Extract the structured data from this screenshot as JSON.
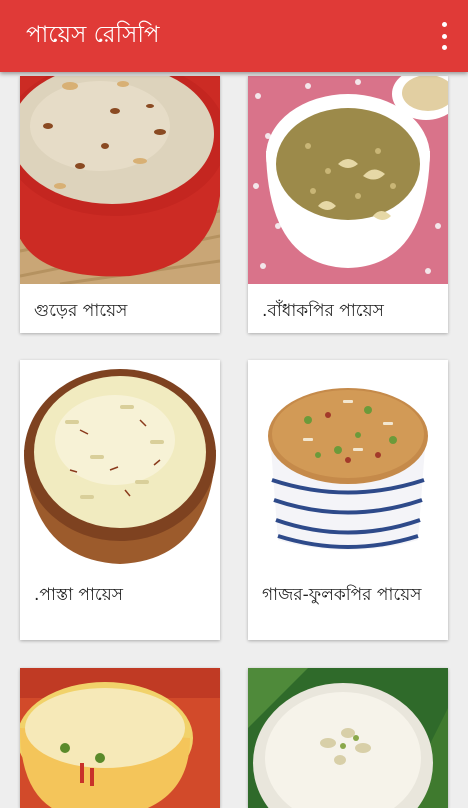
{
  "app": {
    "title": "পায়েস রেসিপি",
    "menu_icon": "overflow-menu-icon"
  },
  "recipes": [
    {
      "name": "গুড়ের পায়েস"
    },
    {
      "name": ".বাঁধাকপির পায়েস"
    },
    {
      "name": ".পাস্তা পায়েস"
    },
    {
      "name": "গাজর-ফুলকপির পায়েস"
    },
    {
      "name": ""
    },
    {
      "name": ""
    }
  ],
  "colors": {
    "toolbar": "#e03a37",
    "background": "#eeeeee",
    "card": "#ffffff"
  }
}
